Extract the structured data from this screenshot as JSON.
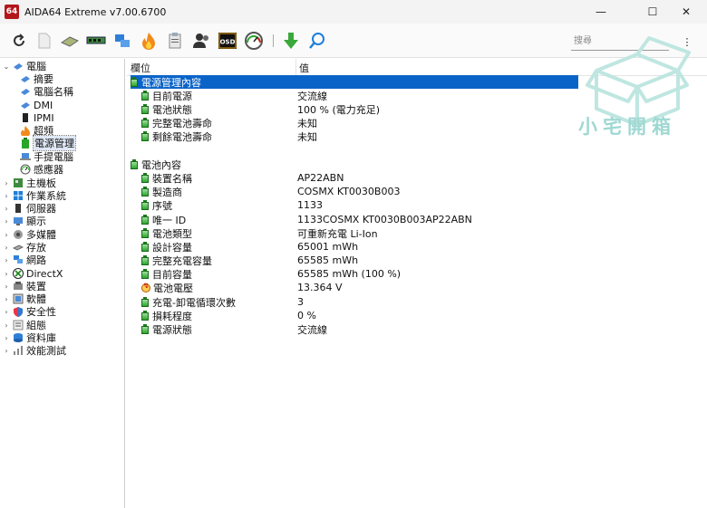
{
  "window": {
    "title": "AIDA64 Extreme v7.00.6700",
    "app_badge": "64",
    "min_glyph": "—",
    "max_glyph": "☐",
    "close_glyph": "✕"
  },
  "toolbar": {
    "buttons": [
      "refresh-icon",
      "report-icon",
      "motherboard-icon",
      "memory-icon",
      "network-icon",
      "benchmark-icon",
      "audit-icon",
      "user-icon",
      "osd-icon",
      "gauge-icon",
      "download-icon",
      "search-icon"
    ],
    "osd_label": "OSD",
    "search_placeholder": "搜尋",
    "menu_glyph": "⋮"
  },
  "tree": {
    "items": [
      {
        "label": "電腦",
        "level": 0,
        "expanded": true,
        "icon": "computer-icon"
      },
      {
        "label": "摘要",
        "level": 1,
        "icon": "computer-icon"
      },
      {
        "label": "電腦名稱",
        "level": 1,
        "icon": "computer-icon"
      },
      {
        "label": "DMI",
        "level": 1,
        "icon": "computer-icon"
      },
      {
        "label": "IPMI",
        "level": 1,
        "icon": "server-icon"
      },
      {
        "label": "超頻",
        "level": 1,
        "icon": "flame-icon"
      },
      {
        "label": "電源管理",
        "level": 1,
        "icon": "battery-icon",
        "selected": true
      },
      {
        "label": "手提電腦",
        "level": 1,
        "icon": "laptop-icon"
      },
      {
        "label": "感應器",
        "level": 1,
        "icon": "gauge-icon"
      },
      {
        "label": "主機板",
        "level": 0,
        "icon": "motherboard-icon"
      },
      {
        "label": "作業系統",
        "level": 0,
        "icon": "windows-icon"
      },
      {
        "label": "伺服器",
        "level": 0,
        "icon": "server-icon"
      },
      {
        "label": "顯示",
        "level": 0,
        "icon": "monitor-icon"
      },
      {
        "label": "多媒體",
        "level": 0,
        "icon": "speaker-icon"
      },
      {
        "label": "存放",
        "level": 0,
        "icon": "disk-icon"
      },
      {
        "label": "網路",
        "level": 0,
        "icon": "network-icon"
      },
      {
        "label": "DirectX",
        "level": 0,
        "icon": "xbox-icon"
      },
      {
        "label": "裝置",
        "level": 0,
        "icon": "device-icon"
      },
      {
        "label": "軟體",
        "level": 0,
        "icon": "software-icon"
      },
      {
        "label": "安全性",
        "level": 0,
        "icon": "shield-icon"
      },
      {
        "label": "組態",
        "level": 0,
        "icon": "config-icon"
      },
      {
        "label": "資料庫",
        "level": 0,
        "icon": "database-icon"
      },
      {
        "label": "效能測試",
        "level": 0,
        "icon": "benchmark-icon"
      }
    ]
  },
  "table": {
    "col_field": "欄位",
    "col_value": "值",
    "sections": [
      {
        "title": "電源管理內容",
        "rows": [
          {
            "field": "目前電源",
            "value": "交流線"
          },
          {
            "field": "電池狀態",
            "value": "100 % (電力充足)"
          },
          {
            "field": "完整電池壽命",
            "value": "未知"
          },
          {
            "field": "剩餘電池壽命",
            "value": "未知"
          }
        ]
      },
      {
        "title": "電池內容",
        "rows": [
          {
            "field": "裝置名稱",
            "value": "AP22ABN"
          },
          {
            "field": "製造商",
            "value": "COSMX KT0030B003"
          },
          {
            "field": "序號",
            "value": "1133"
          },
          {
            "field": "唯一 ID",
            "value": "1133COSMX KT0030B003AP22ABN"
          },
          {
            "field": "電池類型",
            "value": "可重新充電 Li-Ion"
          },
          {
            "field": "設計容量",
            "value": "65001 mWh"
          },
          {
            "field": "完整充電容量",
            "value": "65585 mWh"
          },
          {
            "field": "目前容量",
            "value": "65585 mWh  (100 %)"
          },
          {
            "field": "電池電壓",
            "value": "13.364 V",
            "icon": "voltage-icon"
          },
          {
            "field": "充電-卸電循環次數",
            "value": "3"
          },
          {
            "field": "損耗程度",
            "value": "0 %"
          },
          {
            "field": "電源狀態",
            "value": "交流線"
          }
        ]
      }
    ]
  },
  "watermark": {
    "text": "小宅開箱",
    "color": "#9fd8d2"
  },
  "colors": {
    "selection": "#0a64c8",
    "battery": "#2aa52a",
    "brand": "#b3171a"
  }
}
